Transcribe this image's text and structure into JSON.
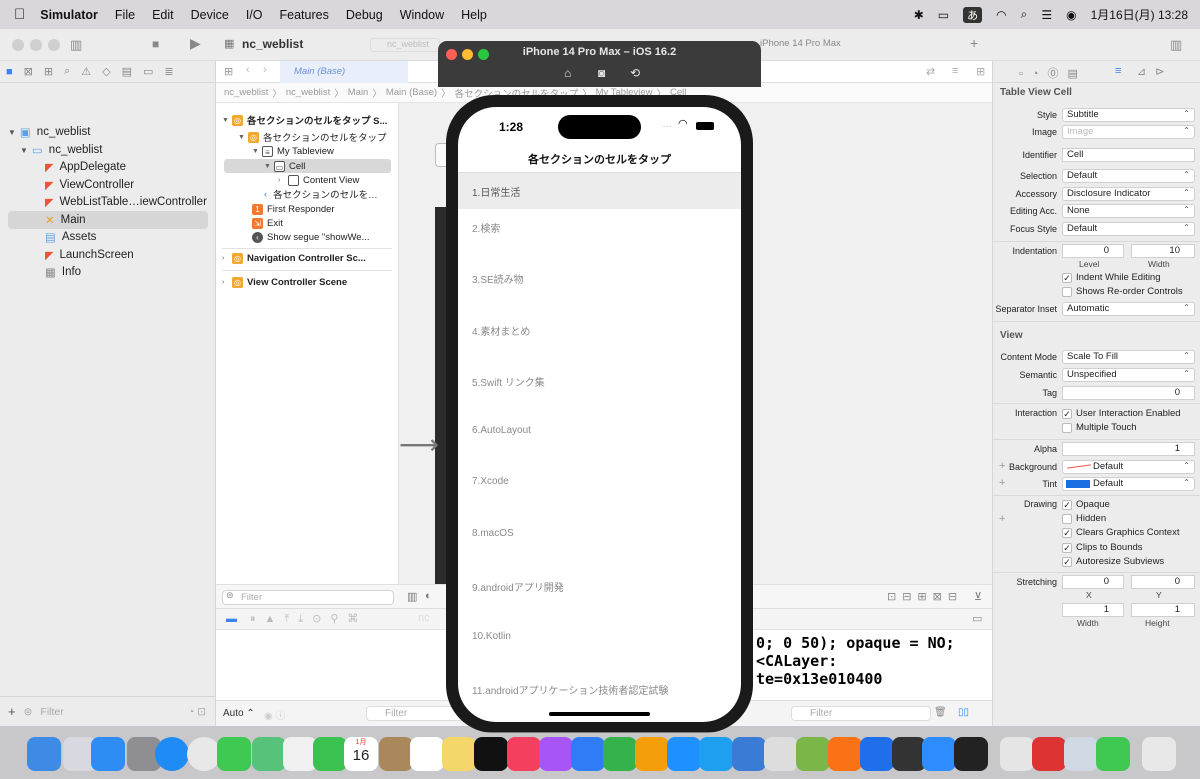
{
  "menubar": {
    "app_name": "Simulator",
    "items": [
      "File",
      "Edit",
      "Device",
      "I/O",
      "Features",
      "Debug",
      "Window",
      "Help"
    ],
    "ime": "あ",
    "clock": "1月16日(月)  13:28"
  },
  "xcode": {
    "project_title": "nc_weblist",
    "tabs": [
      "nc_weblist",
      "iPhone 14 Pro Max"
    ],
    "jump_tab": "Main (Base)",
    "breadcrumb": [
      "nc_weblist",
      "nc_weblist",
      "Main",
      "Main (Base)",
      "各セクションのセルをタップ",
      "My Tableview",
      "Cell"
    ],
    "navigator": {
      "root": "nc_weblist",
      "group": "nc_weblist",
      "files": [
        "AppDelegate",
        "ViewController",
        "WebListTable…iewController",
        "Main",
        "Assets",
        "LaunchScreen",
        "Info"
      ],
      "selected": "Main",
      "filter_placeholder": "Filter"
    },
    "outline": {
      "scene": "各セクションのセルをタップ S...",
      "controller": "各セクションのセルをタップ",
      "tableview": "My Tableview",
      "cell": "Cell",
      "content_view": "Content View",
      "nav_item": "各セクションのセルを…",
      "first_responder": "First Responder",
      "exit": "Exit",
      "segue": "Show segue \"showWe...",
      "nav_scene": "Navigation Controller Sc...",
      "vc_scene": "View Controller Scene",
      "filter_placeholder": "Filter"
    },
    "console_lines": [
      "0; 0 50); opaque = NO;",
      "<CALayer:",
      "te=0x13e010400"
    ],
    "bottom": {
      "auto": "Auto ⌃",
      "filter1": "Filter",
      "filter2": "Filter"
    }
  },
  "inspector": {
    "section1_title": "Table View Cell",
    "style_label": "Style",
    "style": "Subtitle",
    "image_label": "Image",
    "image_placeholder": "Image",
    "identifier_label": "Identifier",
    "identifier": "Cell",
    "selection_label": "Selection",
    "selection": "Default",
    "accessory_label": "Accessory",
    "accessory": "Disclosure Indicator",
    "editing_acc_label": "Editing Acc.",
    "editing_acc": "None",
    "focus_label": "Focus Style",
    "focus": "Default",
    "indentation_label": "Indentation",
    "indent_level": "0",
    "indent_width": "10",
    "level_label": "Level",
    "width_label": "Width",
    "indent_while_editing": "Indent While Editing",
    "shows_reorder": "Shows Re-order Controls",
    "separator_label": "Separator Inset",
    "separator": "Automatic",
    "section2_title": "View",
    "content_mode_label": "Content Mode",
    "content_mode": "Scale To Fill",
    "semantic_label": "Semantic",
    "semantic": "Unspecified",
    "tag_label": "Tag",
    "tag": "0",
    "interaction_label": "Interaction",
    "user_interaction": "User Interaction Enabled",
    "multiple_touch": "Multiple Touch",
    "alpha_label": "Alpha",
    "alpha": "1",
    "background_label": "Background",
    "background": "Default",
    "tint_label": "Tint",
    "tint": "Default",
    "tint_color": "#1a6ee0",
    "drawing_label": "Drawing",
    "opaque": "Opaque",
    "hidden": "Hidden",
    "clears": "Clears Graphics Context",
    "clips": "Clips to Bounds",
    "autoresize": "Autoresize Subviews",
    "stretching_label": "Stretching",
    "stretch_x": "0",
    "stretch_y": "0",
    "stretch_w": "1",
    "stretch_h": "1",
    "x_label": "X",
    "y_label": "Y",
    "w_label": "Width",
    "h_label": "Height"
  },
  "simulator": {
    "title": "iPhone 14 Pro Max – iOS 16.2",
    "time": "1:28",
    "nav_title": "各セクションのセルをタップ",
    "cells": [
      "1.日常生活",
      "2.検索",
      "3.SE読み物",
      "4.素材まとめ",
      "5.Swift リンク集",
      "6.AutoLayout",
      "7.Xcode",
      "8.macOS",
      "9.androidアプリ開発",
      "10.Kotlin",
      "11.androidアプリケーション技術者認定試験"
    ]
  },
  "dock": {
    "calendar_day": "16",
    "calendar_month": "1月"
  }
}
